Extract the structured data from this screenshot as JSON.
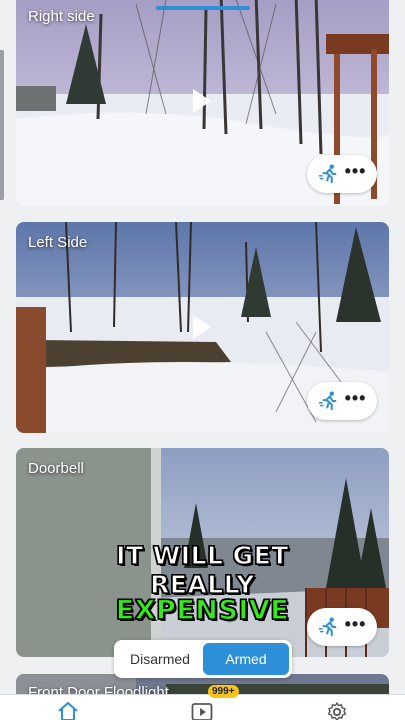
{
  "cameras": [
    {
      "label": "Right side"
    },
    {
      "label": "Left Side"
    },
    {
      "label": "Doorbell"
    },
    {
      "label": "Front Door Floodlight"
    }
  ],
  "overlay": {
    "line1": "IT WILL GET",
    "line2": "REALLY",
    "line3": "EXPENSIVE"
  },
  "mode_toggle": {
    "disarmed": "Disarmed",
    "armed": "Armed",
    "selected": "Armed"
  },
  "bottom_nav": {
    "events_badge": "999+",
    "items": [
      "home-icon",
      "video-play-icon",
      "gear-icon"
    ]
  },
  "colors": {
    "accent": "#2d8fd7",
    "motion_icon": "#2f8fd6",
    "badge": "#f6c41a",
    "overlay_highlight": "#35ea1b"
  }
}
